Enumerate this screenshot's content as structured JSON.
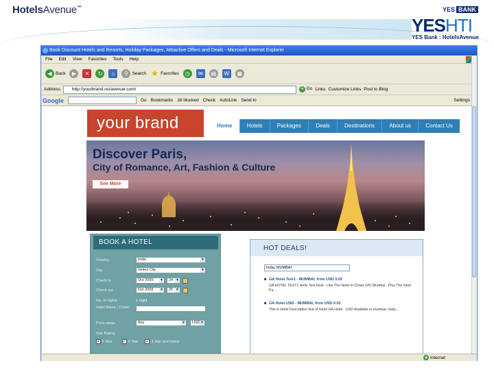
{
  "slide": {
    "left_logo_text": "Hotels",
    "left_logo_text2": "Avenue",
    "left_logo_tm": "™",
    "right_logo_bank_prefix": "YES",
    "right_logo_bank_box": "BANK",
    "right_logo_big_yes": "YES",
    "right_logo_big_hti": "HTI",
    "right_logo_small": "YES Bank : HotelsAvenue"
  },
  "browser": {
    "title": "Book Discount Hotels and Resorts, Holiday Packages, Attractive Offers and Deals - Microsoft Internet Explorer",
    "menu": [
      "File",
      "Edit",
      "View",
      "Favorites",
      "Tools",
      "Help"
    ],
    "toolbar": {
      "back": "Back",
      "search": "Search",
      "favorites": "Favorites"
    },
    "address_label": "Address",
    "address_value": "http://yourbrand.rezavenue.com/",
    "go": "Go",
    "links": "Links",
    "links2": "Customize Links",
    "links3": "Post to Blog",
    "google_label": "Google",
    "google_go": "Go",
    "bookmarks": "Bookmarks",
    "blocked": "16 blocked",
    "check": "Check",
    "autolink": "AutoLink",
    "sendto": "Send to",
    "settings": "Settings",
    "status_zone": "Internet",
    "site": {
      "brand": "your brand",
      "nav": [
        "Home",
        "Hotels",
        "Packages",
        "Deals",
        "Destinations",
        "About us",
        "Contact Us"
      ],
      "hero_line1": "Discover Paris,",
      "hero_line2": "City of Romance, Art, Fashion & Culture",
      "hero_button": "See More",
      "book": {
        "title": "BOOK A HOTEL",
        "country_label": "Country",
        "country_value": "India",
        "city_label": "City",
        "city_value": "Select City",
        "checkin_label": "Check In",
        "checkin_month": "Oct 2009",
        "checkin_day": "24",
        "checkout_label": "Check out",
        "checkout_month": "Oct 2009",
        "checkout_day": "25",
        "nights_label": "No. of nights",
        "nights_value": "1 night",
        "hotel_label": "Hotel Name / Chain",
        "price_label": "Price range",
        "price_value": "Any",
        "currency_value": "USD",
        "star_label": "Star Rating",
        "star5": "5 Star",
        "star4": "4 Star",
        "star3": "3 Star and below"
      },
      "deals": {
        "title": "HOT DEALS!",
        "select_value": "India, MUMBAI",
        "items": [
          {
            "title": "GA Hotel Test1 - MUMBAI, from USD 0.02",
            "desc": "GA HOTEL TEST1 Hello Test Deal - Like The Hotel in Chaar (Vit) Mumbai - Plus The hotel Pa..."
          },
          {
            "title": "GA Hotel USD - MUMBAI, from USD 0.03",
            "desc": "This is Hotel Description test of Hotel GA Hotel - USD Available in mumbai, India..."
          }
        ]
      }
    }
  }
}
